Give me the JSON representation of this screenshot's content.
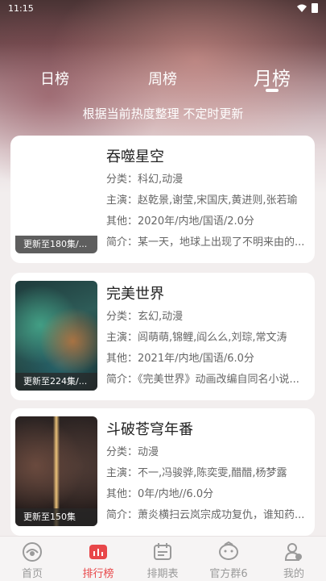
{
  "status_bar": {
    "time": "11:15"
  },
  "tabs": [
    {
      "label": "日榜"
    },
    {
      "label": "周榜"
    },
    {
      "label": "月榜"
    }
  ],
  "subtitle": "根据当前热度整理 不定时更新",
  "cards": [
    {
      "title": "吞噬星空",
      "caption": "更新至180集/...",
      "category": "分类：科幻,动漫",
      "cast": "主演：赵乾景,谢莹,宋国庆,黄进则,张若瑜",
      "other": "其他：2020年/内地/国语/2.0分",
      "summary": "简介：某一天，地球上出现了不明来由的..."
    },
    {
      "title": "完美世界",
      "caption": "更新至224集/...",
      "category": "分类：玄幻,动漫",
      "cast": "主演：闾萌萌,锦鲤,阎么么,刘琮,常文涛",
      "other": "其他：2021年/内地/国语/6.0分",
      "summary": "简介：《完美世界》动画改编自同名小说..."
    },
    {
      "title": "斗破苍穹年番",
      "caption": "更新至150集",
      "category": "分类：动漫",
      "cast": "主演：不一,冯骏骅,陈奕雯,醋醋,杨梦露",
      "other": "其他：0年/内地//6.0分",
      "summary": "简介：萧炎横扫云岚宗成功复仇，谁知药..."
    }
  ],
  "bottom_nav": [
    {
      "label": "首页",
      "icon": "home-icon"
    },
    {
      "label": "排行榜",
      "icon": "chart-icon"
    },
    {
      "label": "排期表",
      "icon": "calendar-icon"
    },
    {
      "label": "官方群6",
      "icon": "group-icon"
    },
    {
      "label": "我的",
      "icon": "profile-icon"
    }
  ],
  "colors": {
    "accent": "#e8474a",
    "nav_inactive": "#9a9a9a"
  }
}
